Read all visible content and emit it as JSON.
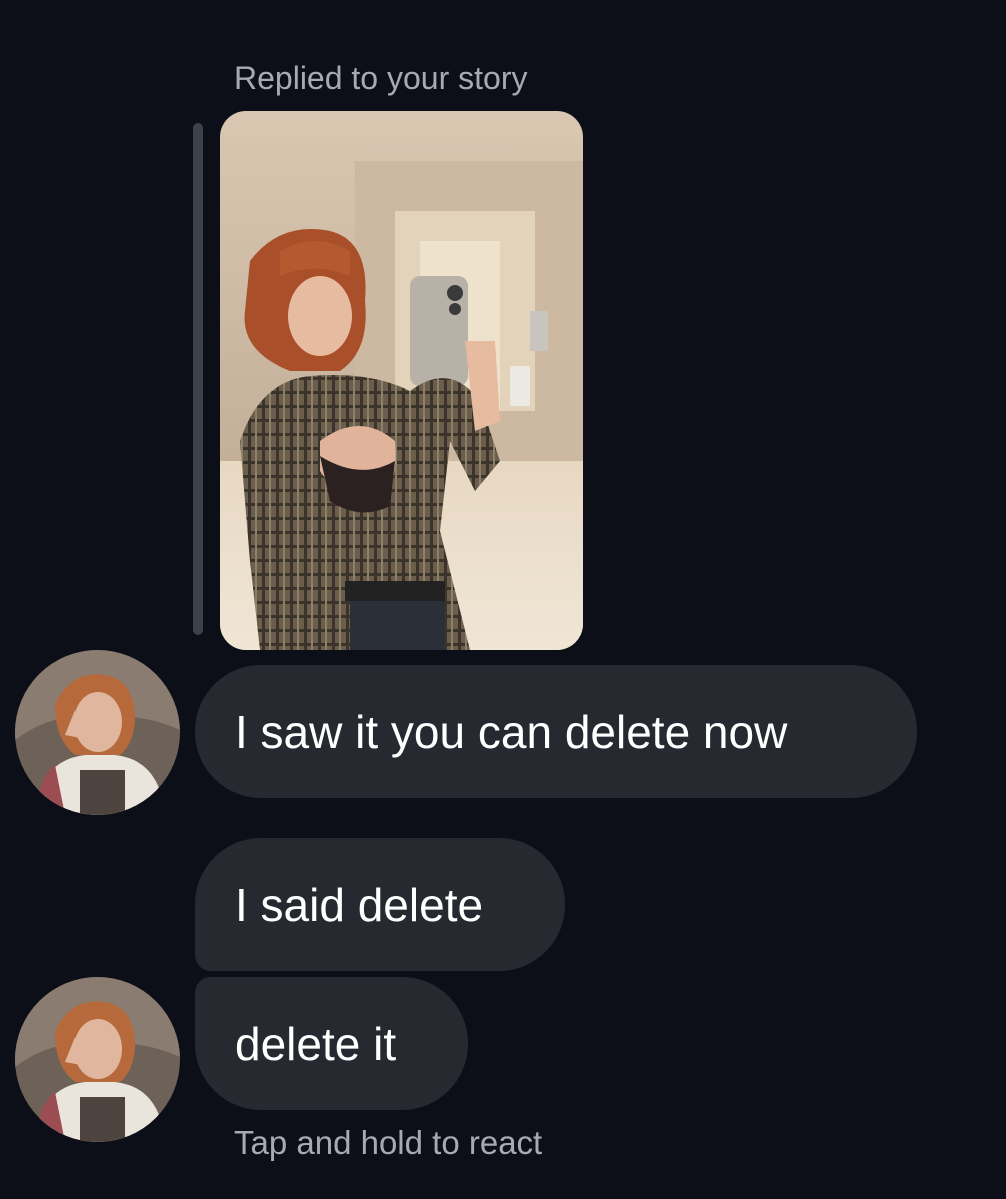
{
  "story_reply": {
    "label": "Replied to your story",
    "image_description": "mirror-selfie-story-photo"
  },
  "messages": [
    {
      "text": "I saw it you can delete now",
      "has_avatar": true
    },
    {
      "text": "I said delete",
      "has_avatar": false
    },
    {
      "text": "delete it",
      "has_avatar": true
    }
  ],
  "hint": "Tap and hold to react",
  "colors": {
    "background": "#0c0f17",
    "bubble": "#26292f",
    "secondary_text": "#a7aab2",
    "reply_bar": "#3d414a"
  }
}
